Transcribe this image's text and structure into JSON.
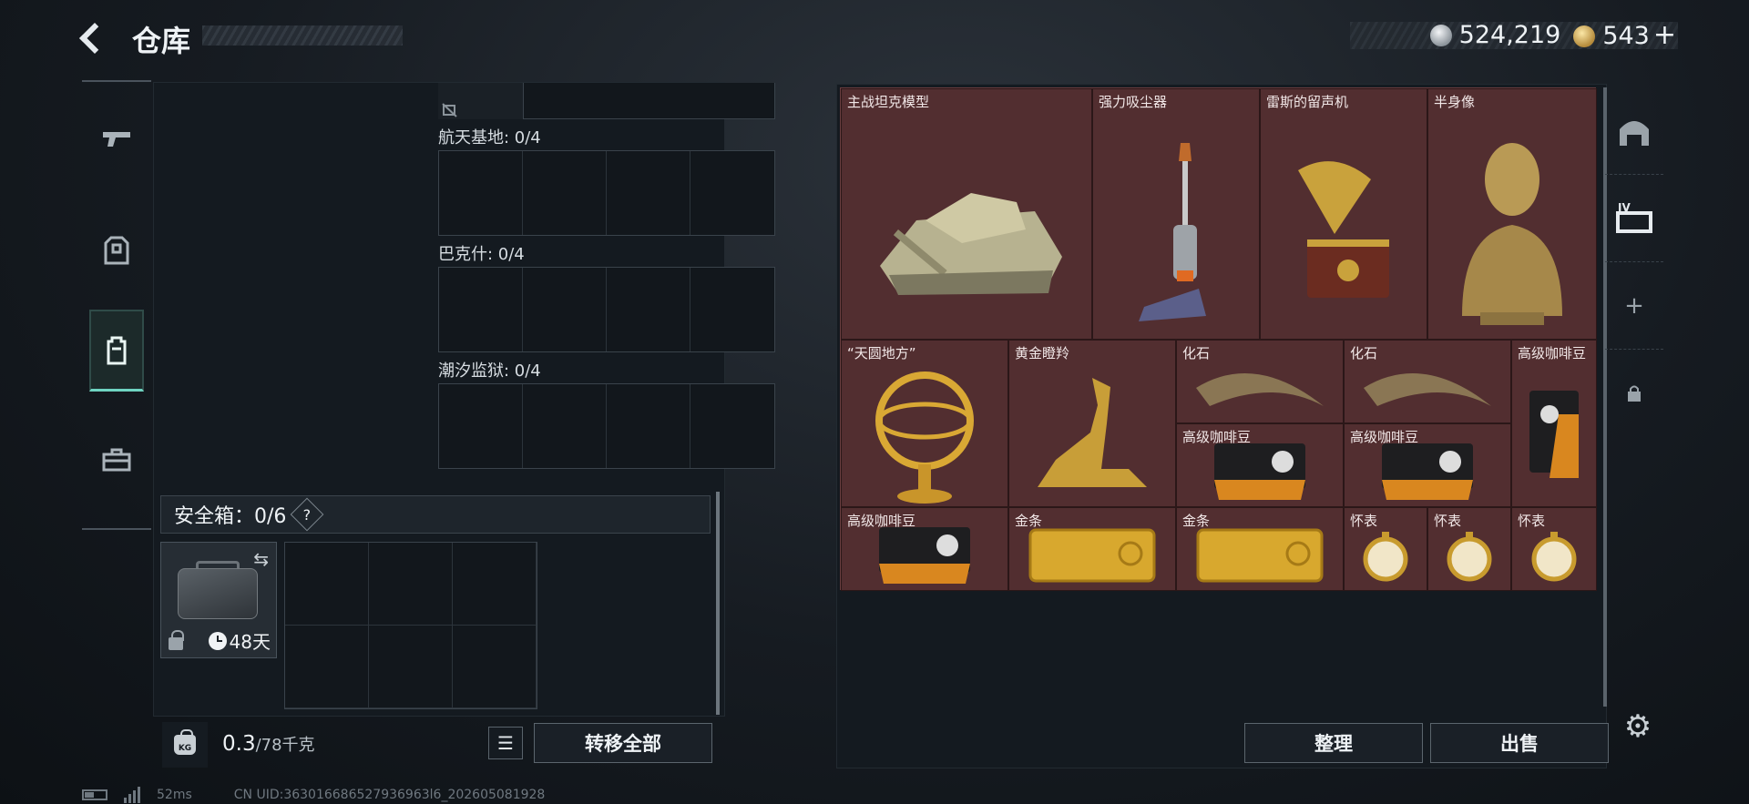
{
  "header": {
    "title": "仓库",
    "currencies": [
      {
        "icon": "silver-coin-icon",
        "value": "524,219"
      },
      {
        "icon": "gold-coin-icon",
        "value": "543"
      }
    ],
    "add_label": "+"
  },
  "left_tabs": [
    {
      "name": "weapons",
      "icon": "gun-icon",
      "active": false
    },
    {
      "name": "armor",
      "icon": "vest-icon",
      "active": false
    },
    {
      "name": "backpack",
      "icon": "backpack-icon",
      "active": true
    },
    {
      "name": "case",
      "icon": "briefcase-icon",
      "active": false
    }
  ],
  "sections": [
    {
      "label": "航天基地: 0/4"
    },
    {
      "label": "巴克什: 0/4"
    },
    {
      "label": "潮汐监狱: 0/4"
    }
  ],
  "safe_box": {
    "label": "安全箱：0/6",
    "help": "?",
    "days": "48天"
  },
  "weight": {
    "icon_text": "KG",
    "current": "0.3",
    "capacity": "/78千克"
  },
  "buttons": {
    "transfer_all": "转移全部",
    "organize": "整理",
    "sell": "出售"
  },
  "stash_items": [
    {
      "label": "主战坦克模型",
      "icon": "tank-model-icon"
    },
    {
      "label": "强力吸尘器",
      "icon": "vacuum-cleaner-icon"
    },
    {
      "label": "雷斯的留声机",
      "icon": "gramophone-icon"
    },
    {
      "label": "半身像",
      "icon": "bust-statue-icon"
    },
    {
      "label": "“天圆地方”",
      "icon": "armillary-sphere-icon"
    },
    {
      "label": "黄金瞪羚",
      "icon": "golden-gazelle-icon"
    },
    {
      "label": "化石",
      "icon": "fossil-claw-icon"
    },
    {
      "label": "化石",
      "icon": "fossil-claw-icon"
    },
    {
      "label": "高级咖啡豆",
      "icon": "coffee-bag-icon"
    },
    {
      "label": "高级咖啡豆",
      "icon": "coffee-bag-icon"
    },
    {
      "label": "高级咖啡豆",
      "icon": "coffee-bag-icon"
    },
    {
      "label": "高级咖啡豆",
      "icon": "coffee-bag-icon"
    },
    {
      "label": "金条",
      "icon": "gold-bar-icon"
    },
    {
      "label": "金条",
      "icon": "gold-bar-icon"
    },
    {
      "label": "怀表",
      "icon": "pocket-watch-icon"
    },
    {
      "label": "怀表",
      "icon": "pocket-watch-icon"
    },
    {
      "label": "怀表",
      "icon": "pocket-watch-icon"
    }
  ],
  "right_tabs": [
    {
      "name": "safehouse",
      "icon": "arch-icon"
    },
    {
      "name": "level-iv-storage",
      "icon": "level-iv-icon"
    },
    {
      "name": "add",
      "icon": "plus-icon",
      "text": "+"
    },
    {
      "name": "locked",
      "icon": "lock-icon"
    }
  ],
  "footer": {
    "ping": "52ms",
    "uid": "CN UID:363016686527936963l6_202605081928"
  },
  "colors": {
    "accent_teal": "#6fd3c1",
    "stash_bg": "#522e30",
    "panel_bg": "#141a20"
  }
}
